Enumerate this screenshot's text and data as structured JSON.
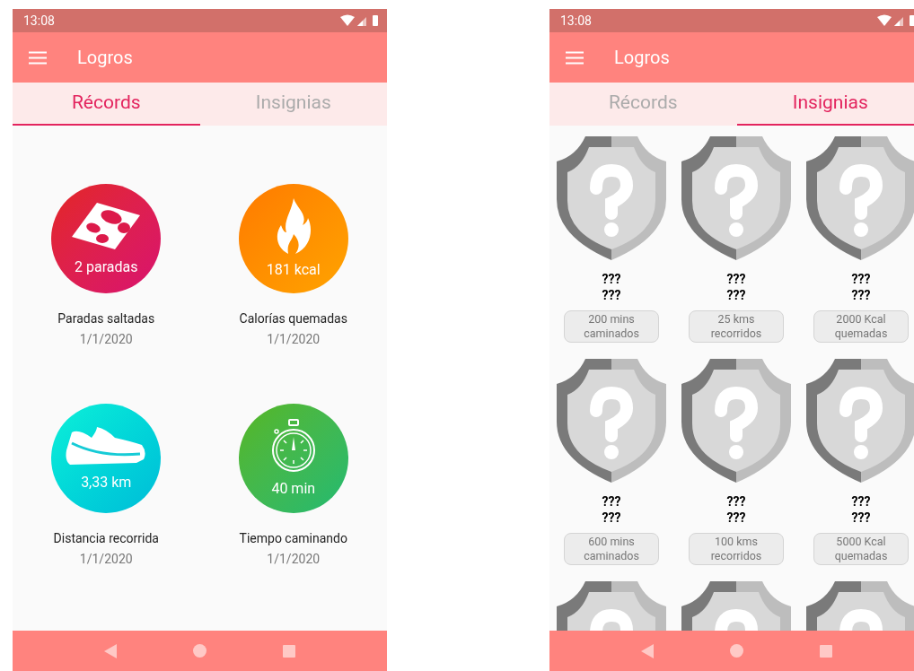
{
  "screens": [
    {
      "status_bar": {
        "time": "13:08"
      },
      "app_bar": {
        "title": "Logros"
      },
      "tabs": [
        {
          "label": "Récords",
          "selected": true
        },
        {
          "label": "Insignias",
          "selected": false
        }
      ],
      "records": [
        {
          "kind": "stops",
          "value": "2 paradas",
          "label": "Paradas saltadas",
          "date": "1/1/2020"
        },
        {
          "kind": "calories",
          "value": "181 kcal",
          "label": "Calorías quemadas",
          "date": "1/1/2020"
        },
        {
          "kind": "distance",
          "value": "3,33 km",
          "label": "Distancia recorrida",
          "date": "1/1/2020"
        },
        {
          "kind": "time",
          "value": "40 min",
          "label": "Tiempo caminando",
          "date": "1/1/2020"
        }
      ]
    },
    {
      "status_bar": {
        "time": "13:08"
      },
      "app_bar": {
        "title": "Logros"
      },
      "tabs": [
        {
          "label": "Récords",
          "selected": false
        },
        {
          "label": "Insignias",
          "selected": true
        }
      ],
      "badges": [
        {
          "locked": true,
          "title_lines": [
            "???",
            "???"
          ],
          "requirement": "200 mins caminados"
        },
        {
          "locked": true,
          "title_lines": [
            "???",
            "???"
          ],
          "requirement": "25 kms recorridos"
        },
        {
          "locked": true,
          "title_lines": [
            "???",
            "???"
          ],
          "requirement": "2000 Kcal quemadas"
        },
        {
          "locked": true,
          "title_lines": [
            "???",
            "???"
          ],
          "requirement": "600 mins caminados"
        },
        {
          "locked": true,
          "title_lines": [
            "???",
            "???"
          ],
          "requirement": "100 kms recorridos"
        },
        {
          "locked": true,
          "title_lines": [
            "???",
            "???"
          ],
          "requirement": "5000 Kcal quemadas"
        },
        {
          "locked": true
        },
        {
          "locked": true
        },
        {
          "locked": true
        }
      ]
    }
  ]
}
